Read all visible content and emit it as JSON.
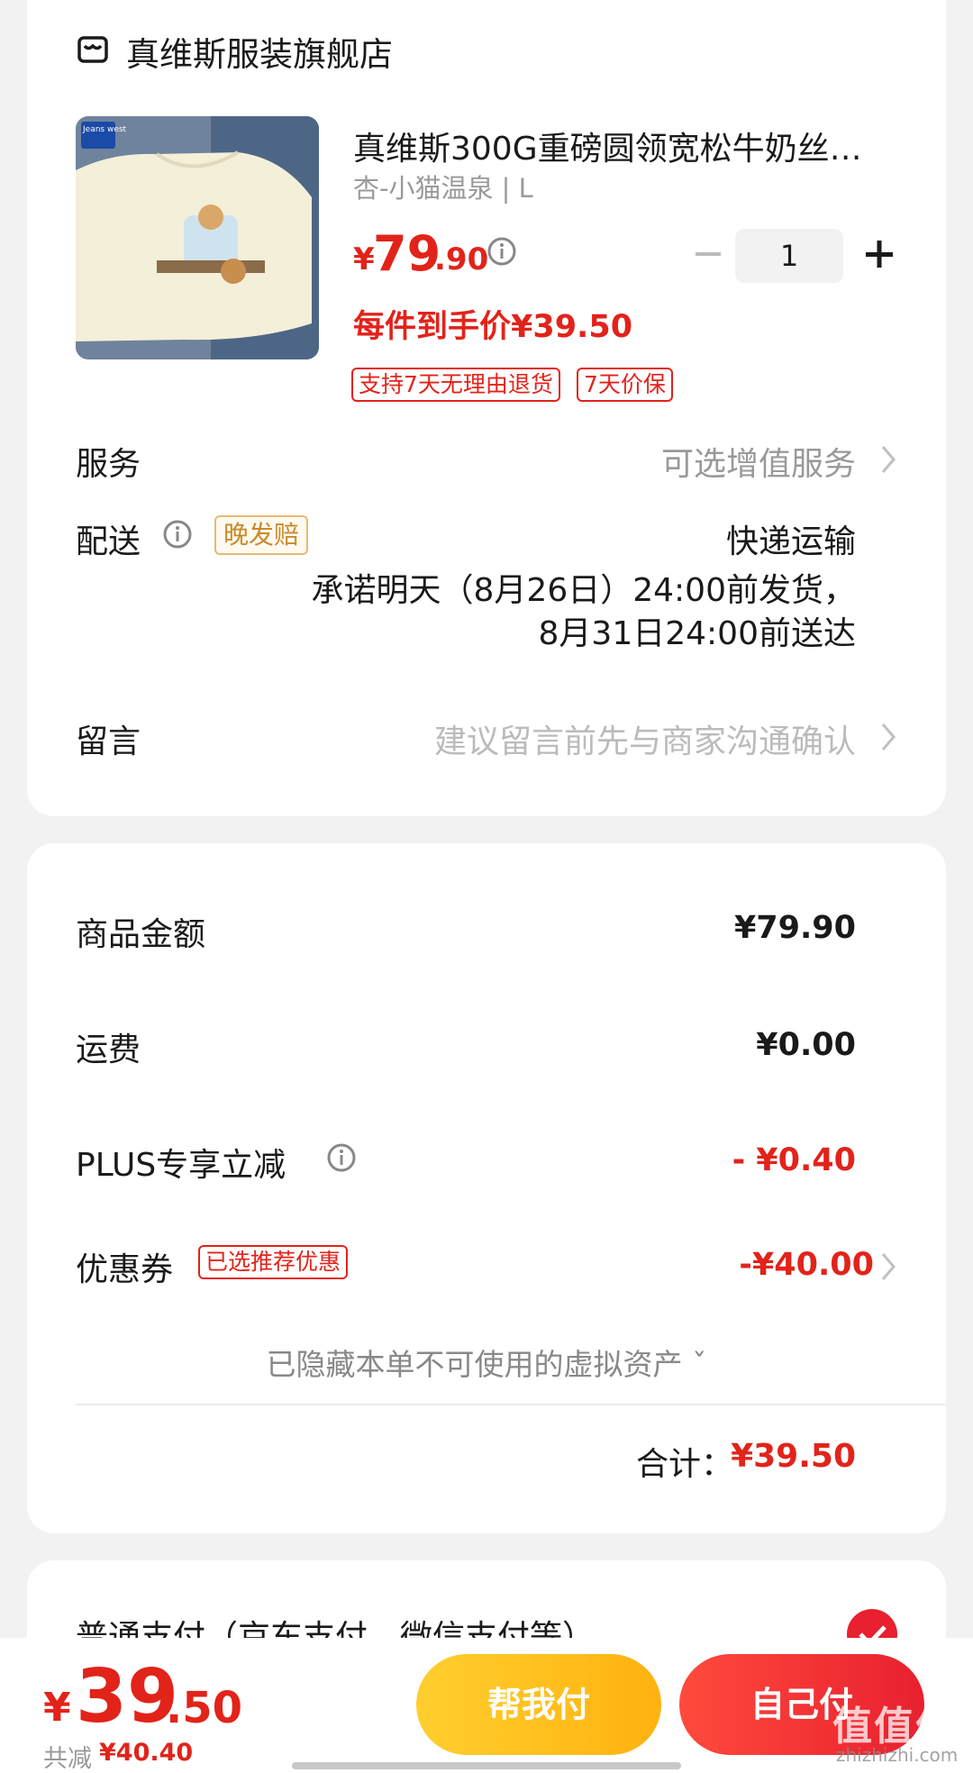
{
  "store": {
    "name": "真维斯服装旗舰店",
    "icon": "store-icon"
  },
  "product": {
    "title": "真维斯300G重磅圆领宽松牛奶丝…",
    "variant": "杏-小猫温泉 | L",
    "price_symbol": "¥",
    "price_int": "79",
    "price_dec": ".90",
    "quantity": "1",
    "unit_price_label": "每件到手价¥39.50",
    "tags": [
      "支持7天无理由退货",
      "7天价保"
    ],
    "thumb_brand": "Jeans west"
  },
  "service": {
    "label": "服务",
    "value": "可选增值服务"
  },
  "shipping": {
    "label": "配送",
    "late_badge": "晚发赔",
    "method": "快递运输",
    "line1": "承诺明天（8月26日）24:00前发货，",
    "line2": "8月31日24:00前送达"
  },
  "message": {
    "label": "留言",
    "hint": "建议留言前先与商家沟通确认"
  },
  "summary": {
    "goods_label": "商品金额",
    "goods_value": "¥79.90",
    "freight_label": "运费",
    "freight_value": "¥0.00",
    "plus_label": "PLUS专享立减",
    "plus_value": "- ¥0.40",
    "coupon_label": "优惠券",
    "coupon_badge": "已选推荐优惠",
    "coupon_value": "-¥40.00",
    "hidden_assets": "已隐藏本单不可使用的虚拟资产 ˇ",
    "total_label": "合计：",
    "total_value": "¥39.50"
  },
  "payment": {
    "label": "普通支付（京东支付、微信支付等）"
  },
  "bottom_bar": {
    "price_symbol": "¥",
    "price_int": "39",
    "price_dec": ".50",
    "saved_label": "共减",
    "saved_value": "¥40.40",
    "help_pay": "帮我付",
    "self_pay": "自己付"
  },
  "watermark": {
    "text": "值值值",
    "sub": "zhizhizhi.com"
  },
  "colors": {
    "accent_red": "#e2231a",
    "help_btn": "#ffc11f",
    "self_btn": "#ee2c35",
    "badge_gold": "#c98a2a"
  }
}
